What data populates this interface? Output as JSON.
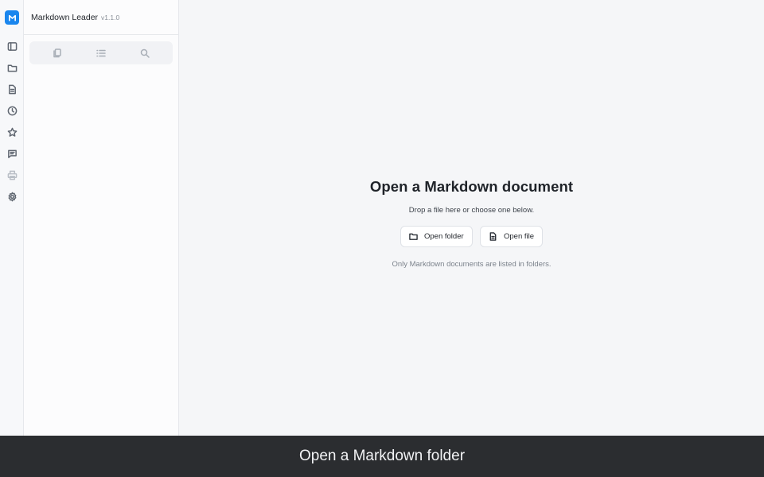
{
  "app": {
    "name": "Markdown Leader",
    "version": "v1.1.0",
    "logo_letter": "M",
    "accent_color": "#1a86ee"
  },
  "activity_bar": {
    "items": [
      {
        "icon": "sidebar-toggle-icon",
        "enabled": true
      },
      {
        "icon": "folder-icon",
        "enabled": true
      },
      {
        "icon": "document-icon",
        "enabled": true
      },
      {
        "icon": "clock-icon",
        "enabled": true
      },
      {
        "icon": "star-icon",
        "enabled": true
      },
      {
        "icon": "comment-icon",
        "enabled": true
      },
      {
        "icon": "printer-icon",
        "enabled": false
      },
      {
        "icon": "gear-icon",
        "enabled": true
      }
    ]
  },
  "sidebar": {
    "tabs": [
      {
        "icon": "files-icon"
      },
      {
        "icon": "outline-list-icon"
      },
      {
        "icon": "search-icon"
      }
    ]
  },
  "main": {
    "title": "Open a Markdown document",
    "subtitle": "Drop a file here or choose one below.",
    "open_folder_label": "Open folder",
    "open_file_label": "Open file",
    "note": "Only Markdown documents are listed in folders."
  },
  "caption": {
    "text": "Open a Markdown folder"
  }
}
